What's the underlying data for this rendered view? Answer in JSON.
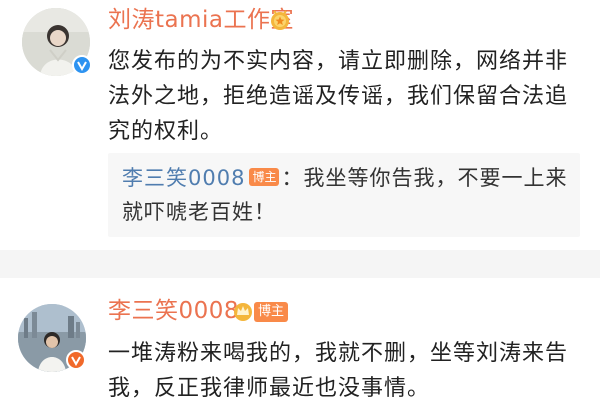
{
  "comments": [
    {
      "username": "刘涛tamia工作室",
      "badge_icon": "medal-icon",
      "verified_color": "#2d93f1",
      "body_lines": [
        "您发布的为不实内容，请立即删除，网络并非",
        "法外之地，拒绝造谣及传谣，我们保留合法追",
        "究的权利。"
      ],
      "reply": {
        "name": "李三笑0008",
        "tag": "博主",
        "separator": "：",
        "text_line1": "我坐等你告我，不要一上来",
        "text_line2": "就吓唬老百姓！"
      }
    },
    {
      "username": "李三笑0008",
      "tag": "博主",
      "badge_icon": "crown-icon",
      "verified_color": "#f1692a",
      "body_lines": [
        "一堆涛粉来喝我的，我就不删，坐等刘涛来告",
        "我，反正我律师最近也没事情。"
      ]
    }
  ],
  "colors": {
    "username": "#eb7350",
    "reply_name": "#507daf",
    "tag_bg": "#f98a49",
    "divider_bg": "#f5f5f5"
  }
}
